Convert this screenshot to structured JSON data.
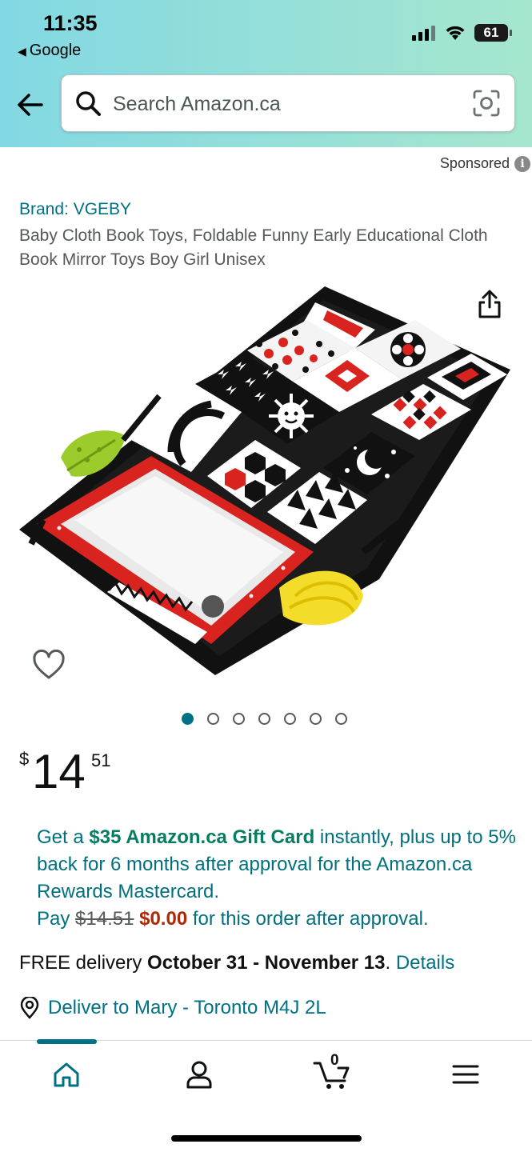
{
  "status_bar": {
    "time": "11:35",
    "back_app": "Google",
    "battery": "61"
  },
  "search": {
    "placeholder": "Search Amazon.ca"
  },
  "sponsored_label": "Sponsored",
  "product": {
    "brand": "Brand: VGEBY",
    "title": "Baby Cloth Book Toys, Foldable Funny Early Educational Cloth Book Mirror Toys Boy Girl Unisex",
    "image_index": 1,
    "image_count": 7,
    "price": {
      "symbol": "$",
      "whole": "14",
      "fraction": "51"
    }
  },
  "promo": {
    "line_prefix": "Get a ",
    "gift_card": "$35 Amazon.ca Gift Card",
    "line_rest": " instantly, plus up to 5% back for 6 months after approval for the Amazon.ca Rewards Mastercard.",
    "pay_label": "Pay ",
    "old_price": "$14.51",
    "new_price": "$0.00",
    "pay_suffix": " for this order after approval."
  },
  "delivery": {
    "prefix": "FREE delivery ",
    "dates": "October 31 - November 13",
    "sep": ". ",
    "details_link": "Details"
  },
  "deliver_to": "Deliver to Mary - Toronto M4J 2L",
  "tabbar": {
    "cart_count": "0",
    "active_tab": "home"
  },
  "colors": {
    "link": "#007185",
    "gift": "#067d62",
    "price_red": "#b12704",
    "header_from": "#82d8e3",
    "header_to": "#a6e6ce"
  }
}
